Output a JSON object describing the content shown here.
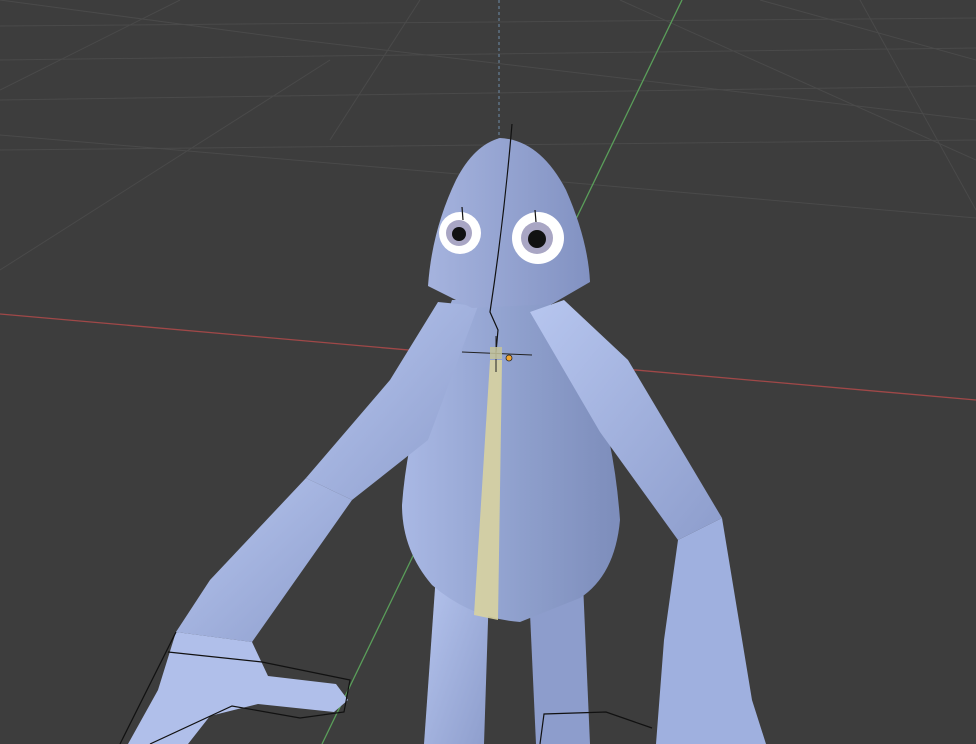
{
  "app": {
    "name": "",
    "editor": "3D Viewport"
  },
  "viewport": {
    "background_color": "#3d3d3d",
    "grid_color": "#4a4a4a",
    "x_axis_color": "#a04848",
    "y_axis_color": "#5a9e5a",
    "z_axis_color": "#6d8aa8"
  },
  "scene": {
    "object": {
      "type": "character-mesh",
      "base_color": "#8e9fcc",
      "highlight_color": "#b7c6ef",
      "seam_color": "#d8d3a0",
      "eyes": 2
    },
    "overlays": [
      "3d-cursor-icon",
      "origin-dot-icon",
      "armature-bone-wires"
    ]
  }
}
